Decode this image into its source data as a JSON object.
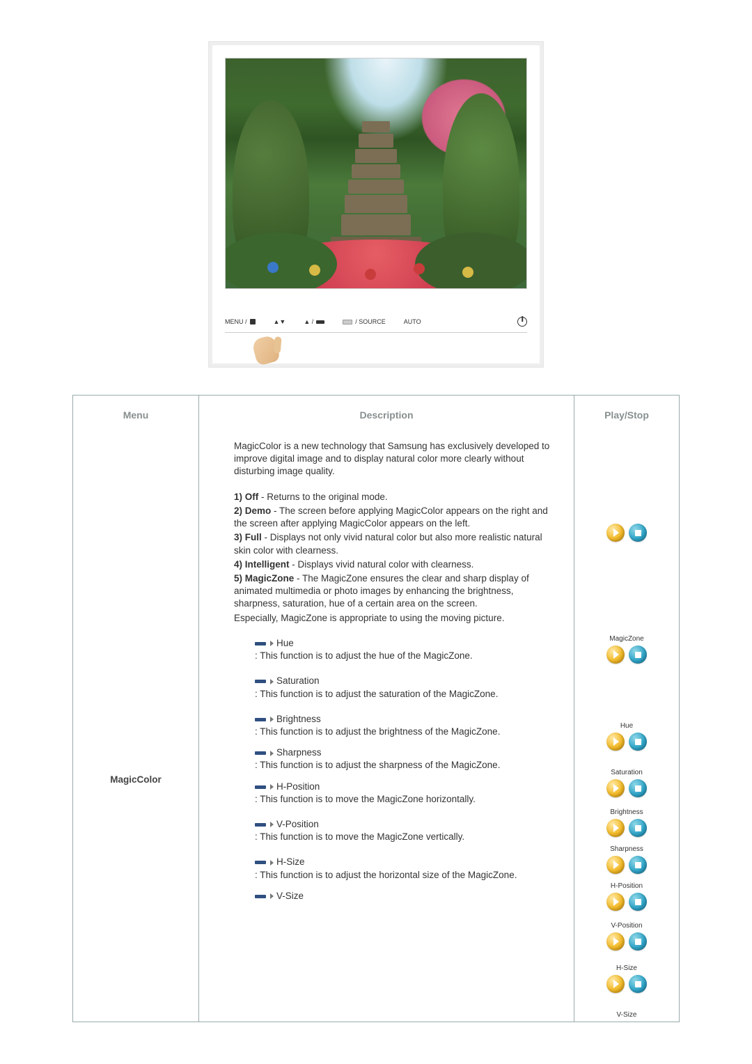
{
  "monitor_buttons": {
    "menu": "MENU /",
    "icons_mid": "",
    "source": "/ SOURCE",
    "auto": "AUTO"
  },
  "table": {
    "headers": {
      "menu": "Menu",
      "description": "Description",
      "play": "Play/Stop"
    },
    "menu_label": "MagicColor",
    "intro": "MagicColor is a new technology that Samsung has exclusively developed to improve digital image and to display natural color more clearly without disturbing image quality.",
    "modes": {
      "off": {
        "label": "1) Off",
        "text": " - Returns to the original mode."
      },
      "demo": {
        "label": "2) Demo",
        "text": " - The screen before applying MagicColor appears on the right and the screen after applying MagicColor appears on the left."
      },
      "full": {
        "label": "3) Full",
        "text": " - Displays not only vivid natural color but also more realistic natural skin color with clearness."
      },
      "intelligent": {
        "label": "4) Intelligent",
        "text": " - Displays vivid natural color with clearness."
      },
      "magiczone": {
        "label": "5) MagicZone",
        "text": " - The MagicZone ensures the clear and sharp display of animated multimedia or photo images by enhancing the brightness, sharpness, saturation, hue of a certain area on the screen."
      },
      "magiczone_extra": "Especially, MagicZone is appropriate to using the moving picture."
    },
    "subs": {
      "hue": {
        "name": "Hue",
        "desc": ": This function is to adjust the hue of the MagicZone."
      },
      "saturation": {
        "name": "Saturation",
        "desc": ": This function is to adjust the saturation of the MagicZone."
      },
      "brightness": {
        "name": "Brightness",
        "desc": ": This function is to adjust the brightness of the MagicZone."
      },
      "sharpness": {
        "name": "Sharpness",
        "desc": ": This function is to adjust the sharpness of the MagicZone."
      },
      "hpos": {
        "name": "H-Position",
        "desc": ": This function is to move the MagicZone horizontally."
      },
      "vpos": {
        "name": "V-Position",
        "desc": ": This function is to move the MagicZone vertically."
      },
      "hsize": {
        "name": "H-Size",
        "desc": ": This function is to adjust the horizontal size of the MagicZone."
      },
      "vsize": {
        "name": "V-Size",
        "desc": ""
      }
    },
    "play_labels": {
      "none": "",
      "magiczone": "MagicZone",
      "hue": "Hue",
      "saturation": "Saturation",
      "brightness": "Brightness",
      "sharpness": "Sharpness",
      "hpos": "H-Position",
      "vpos": "V-Position",
      "hsize": "H-Size",
      "vsize": "V-Size"
    }
  }
}
